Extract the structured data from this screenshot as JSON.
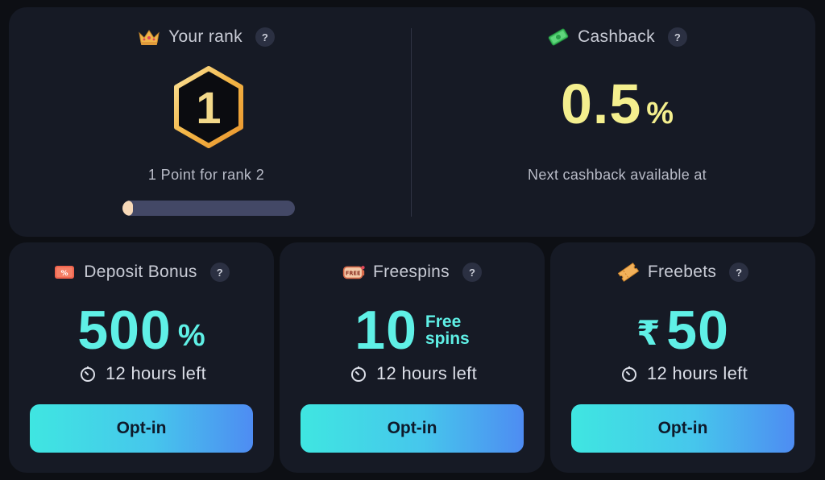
{
  "rank": {
    "label": "Your rank",
    "help": "?",
    "value": "1",
    "next_text": "1 Point for rank 2",
    "progress_fraction": 0.06,
    "icon": "crown-icon"
  },
  "cashback": {
    "label": "Cashback",
    "help": "?",
    "value": "0.5",
    "unit": "%",
    "next_text": "Next cashback available at",
    "icon": "cash-icon"
  },
  "cards": [
    {
      "label": "Deposit Bonus",
      "help": "?",
      "value": "500",
      "unit": "%",
      "timer": "12 hours left",
      "button": "Opt-in",
      "icon": "deposit-coupon-icon"
    },
    {
      "label": "Freespins",
      "help": "?",
      "value": "10",
      "sub_line1": "Free",
      "sub_line2": "spins",
      "timer": "12 hours left",
      "button": "Opt-in",
      "icon": "free-slot-icon",
      "icon_text": "FREE"
    },
    {
      "label": "Freebets",
      "help": "?",
      "currency": "₹",
      "value": "50",
      "timer": "12 hours left",
      "button": "Opt-in",
      "icon": "ticket-icon"
    }
  ],
  "colors": {
    "background": "#0d0f14",
    "panel": "#161a25",
    "cashback_value": "#f4ef8e",
    "card_value": "#5ff0e6",
    "button_gradient_start": "#3fe6e1",
    "button_gradient_end": "#4e8cf2",
    "rank_badge": "#f3c35a"
  }
}
